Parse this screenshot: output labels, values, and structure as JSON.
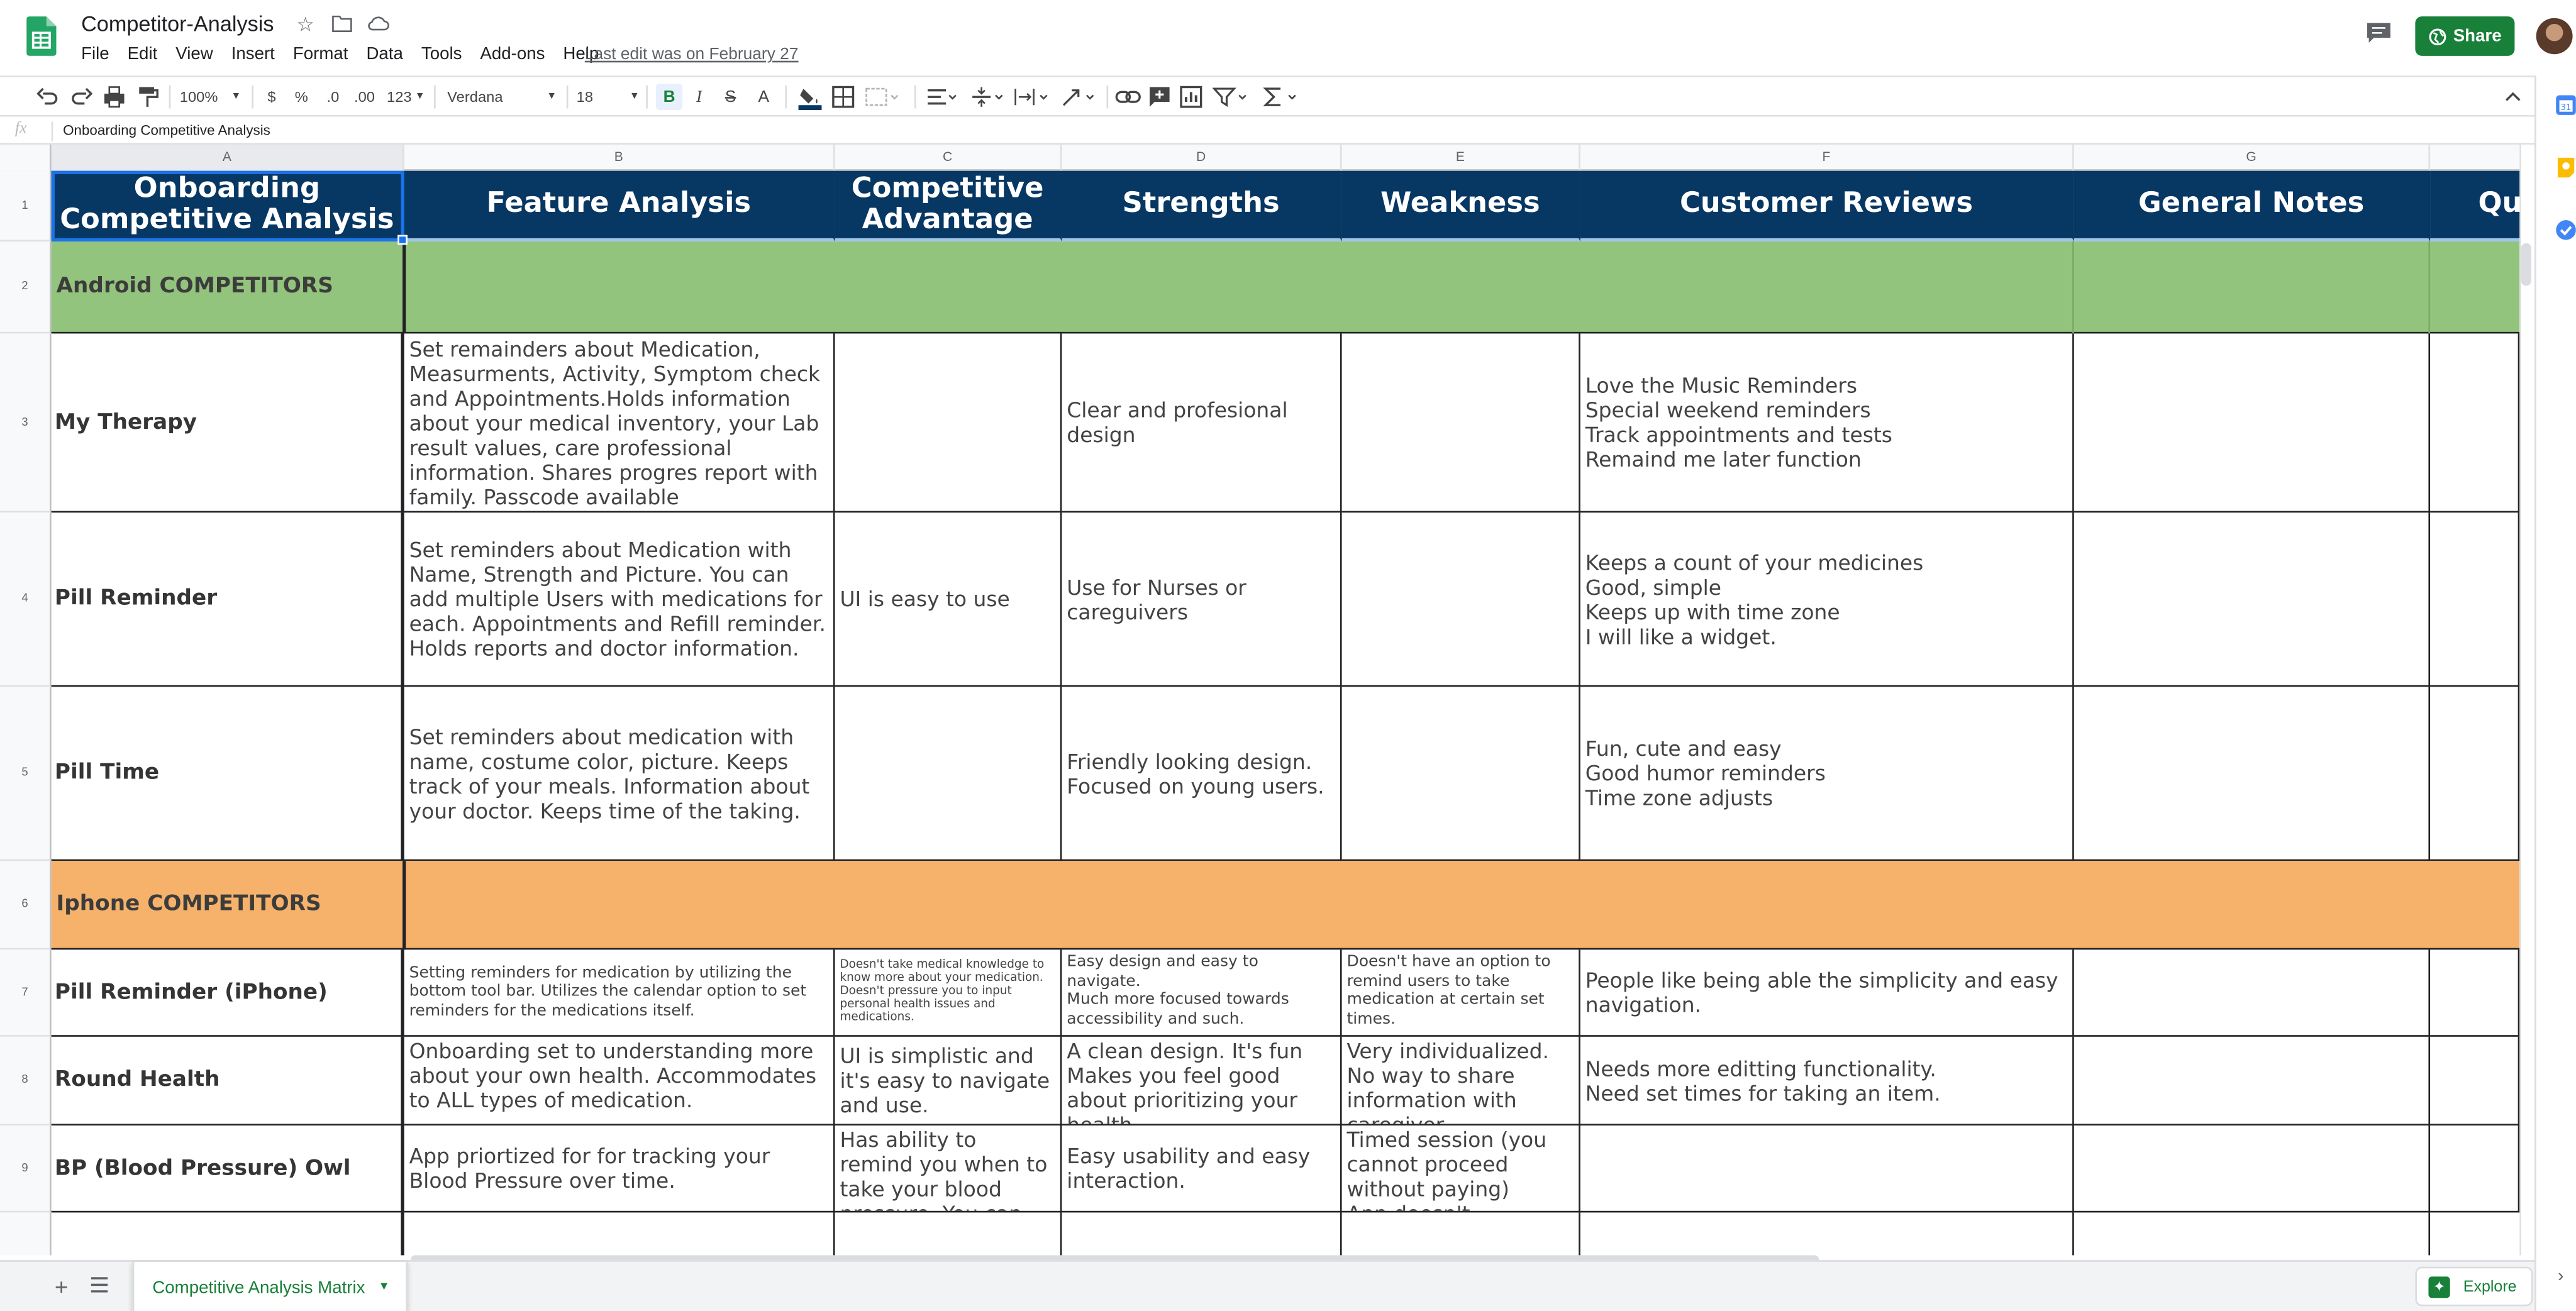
{
  "app": {
    "doc_title": "Competitor-Analysis",
    "last_edit": "Last edit was on February 27",
    "share_label": "Share",
    "menu": [
      "File",
      "Edit",
      "View",
      "Insert",
      "Format",
      "Data",
      "Tools",
      "Add-ons",
      "Help"
    ]
  },
  "toolbar": {
    "zoom": "100%",
    "currency": "$",
    "percent": "%",
    "decimal_less": ".0",
    "decimal_more": ".00",
    "number_format": "123",
    "font": "Verdana",
    "font_size": "18",
    "bold": "B",
    "italic": "I",
    "strike": "S",
    "text_color": "A"
  },
  "formula_bar": {
    "fx": "fx",
    "value": "Onboarding Competitive Analysis"
  },
  "colors": {
    "header_navy": "#073763",
    "android_green": "#93c47d",
    "iphone_orange": "#f6b26b",
    "brand_green": "#188038",
    "selection_blue": "#1a73e8"
  },
  "columns": [
    "A",
    "B",
    "C",
    "D",
    "E",
    "F",
    "G"
  ],
  "rows": [
    "1",
    "2",
    "3",
    "4",
    "5",
    "6",
    "7",
    "8",
    "9"
  ],
  "header": {
    "a": "Onboarding Competitive Analysis",
    "b": "Feature Analysis",
    "c": "Competitive Advantage",
    "d": "Strengths",
    "e": "Weakness",
    "f": "Customer Reviews",
    "g": "General Notes",
    "h": "Qu"
  },
  "sections": {
    "android": "Android COMPETITORS",
    "iphone": "Iphone COMPETITORS"
  },
  "competitors": [
    {
      "name": "My Therapy",
      "feature": "Set remainders about Medication, Measurments, Activity, Symptom check and  Appointments.Holds information about your medical inventory, your Lab result values, care professional information.  Shares progres report with family. Passcode available",
      "advantage": "",
      "strengths": "Clear and profesional design",
      "weakness": "",
      "reviews": "Love the Music Reminders\nSpecial weekend reminders\nTrack appointments and tests\nRemaind me later function"
    },
    {
      "name": "Pill Reminder",
      "feature": "Set reminders about Medication with Name, Strength and Picture. You can add multiple Users with medications for each. Appointments and Refill reminder. Holds reports and doctor information.",
      "advantage": "UI is easy to use",
      "strengths": "Use for Nurses or careguivers",
      "weakness": "",
      "reviews": "Keeps a count of your medicines\nGood, simple\nKeeps up with time zone\nI will like a widget."
    },
    {
      "name": "Pill Time",
      "feature": "Set reminders about medication with name, costume color, picture. Keeps track of your meals. Information about your doctor. Keeps time of the taking.",
      "advantage": "",
      "strengths": "Friendly looking design.\nFocused on young users.",
      "weakness": "",
      "reviews": "Fun, cute and easy\nGood humor reminders\nTime zone adjusts"
    },
    {
      "name": "Pill Reminder (iPhone)",
      "feature": "Setting reminders for medication by utilizing the bottom tool bar. Utilizes the calendar option to set reminders for the medications itself.",
      "advantage": "Doesn't take medical knowledge to know more about your medication. Doesn't pressure you to input personal health issues and medications.",
      "strengths": "Easy design and easy to navigate.\nMuch more focused towards accessibility and such.",
      "weakness": "Doesn't have an option to remind users to take medication at certain set times.",
      "reviews": "People like being able the simplicity and easy navigation."
    },
    {
      "name": "Round Health",
      "feature": "Onboarding set to understanding more about your own health. Accommodates to ALL types of medication.",
      "advantage": "UI is simplistic and it's easy to navigate and use.",
      "strengths": "A clean design. It's fun Makes you feel good about prioritizing your health.",
      "weakness": "Very individualized. No way to share information with caregiver.",
      "reviews": "Needs more editting functionality.\nNeed set times for taking an item."
    },
    {
      "name": "BP (Blood Pressure) Owl",
      "feature": "App priortized for for tracking your Blood Pressure over time.",
      "advantage": "Has ability to remind you when to take your blood pressure. You can customize",
      "strengths": "Easy usability and easy interaction.",
      "weakness": "Timed session (you cannot proceed without paying)\nApp doesn't",
      "reviews": ""
    }
  ],
  "bottom": {
    "add": "+",
    "sheet_tab": "Competitive Analysis Matrix",
    "explore": "Explore"
  }
}
